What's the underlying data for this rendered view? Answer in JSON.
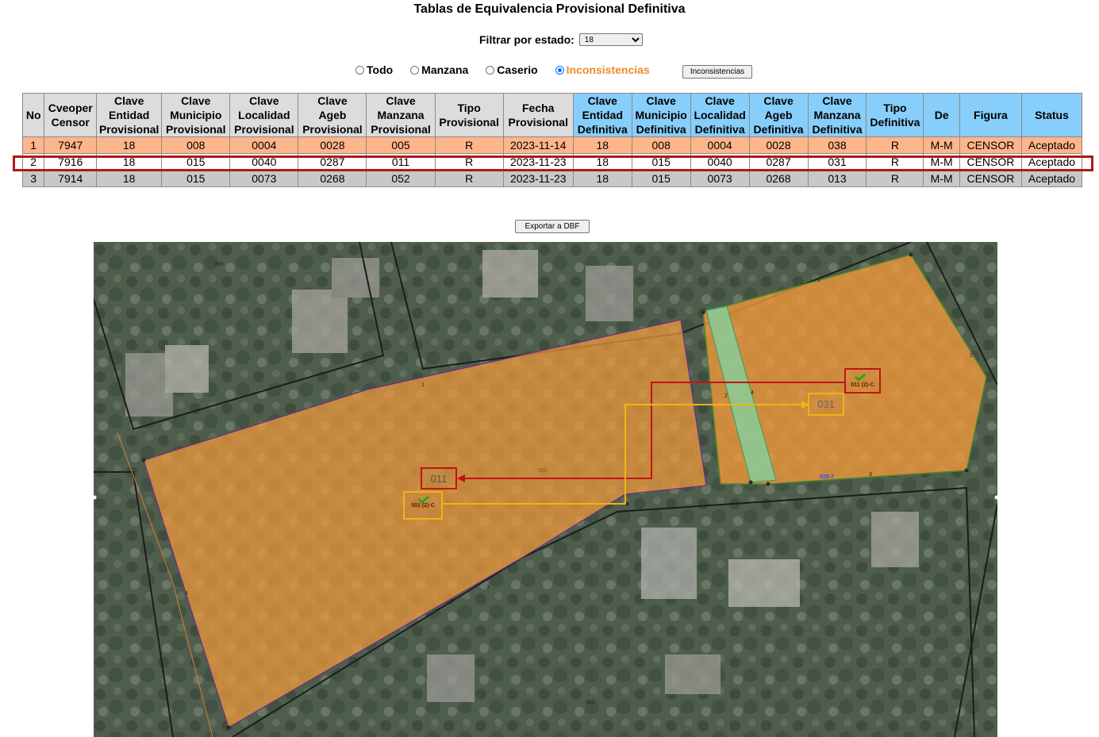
{
  "page": {
    "title": "Tablas de Equivalencia Provisional Definitiva",
    "filter_label": "Filtrar por estado:",
    "filter_value": "18",
    "radios": [
      {
        "label": "Todo",
        "selected": false
      },
      {
        "label": "Manzana",
        "selected": false
      },
      {
        "label": "Caserio",
        "selected": false
      },
      {
        "label": "Inconsistencias",
        "selected": true
      }
    ],
    "inconsistencias_button": "Inconsistencias",
    "export_button": "Exportar a DBF"
  },
  "table": {
    "headers": {
      "no": "No",
      "cveoper": [
        "Cveoper",
        "Censor"
      ],
      "ent_prov": [
        "Clave",
        "Entidad",
        "Provisional"
      ],
      "mun_prov": [
        "Clave",
        "Municipio",
        "Provisional"
      ],
      "loc_prov": [
        "Clave",
        "Localidad",
        "Provisional"
      ],
      "ageb_prov": [
        "Clave",
        "Ageb",
        "Provisional"
      ],
      "mza_prov": [
        "Clave",
        "Manzana",
        "Provisional"
      ],
      "tipo_prov": [
        "Tipo",
        "Provisional"
      ],
      "fecha_prov": [
        "Fecha",
        "Provisional"
      ],
      "ent_def": [
        "Clave",
        "Entidad",
        "Definitiva"
      ],
      "mun_def": [
        "Clave",
        "Municipio",
        "Definitiva"
      ],
      "loc_def": [
        "Clave",
        "Localidad",
        "Definitiva"
      ],
      "ageb_def": [
        "Clave",
        "Ageb",
        "Definitiva"
      ],
      "mza_def": [
        "Clave",
        "Manzana",
        "Definitiva"
      ],
      "tipo_def": [
        "Tipo",
        "Definitiva"
      ],
      "de": "De",
      "figura": "Figura",
      "status": "Status"
    },
    "rows": [
      [
        "1",
        "7947",
        "18",
        "008",
        "0004",
        "0028",
        "005",
        "R",
        "2023-11-14",
        "18",
        "008",
        "0004",
        "0028",
        "038",
        "R",
        "M-M",
        "CENSOR",
        "Aceptado"
      ],
      [
        "2",
        "7916",
        "18",
        "015",
        "0040",
        "0287",
        "011",
        "R",
        "2023-11-23",
        "18",
        "015",
        "0040",
        "0287",
        "031",
        "R",
        "M-M",
        "CENSOR",
        "Aceptado"
      ],
      [
        "3",
        "7914",
        "18",
        "015",
        "0073",
        "0268",
        "052",
        "R",
        "2023-11-23",
        "18",
        "015",
        "0073",
        "0268",
        "013",
        "R",
        "M-M",
        "CENSOR",
        "Aceptado"
      ]
    ],
    "highlighted_row": 2
  },
  "map": {
    "label_011": "011",
    "label_031": "031",
    "label_011c": "011 (2)-C",
    "label_001c": "001 (2)-C",
    "label_028": "028-7",
    "small_labels": {
      "l004": "004",
      "l021": "021",
      "l011s": "011",
      "n1a": "1",
      "n1b": "1",
      "n2": "2",
      "n3a": "3",
      "n3b": "3",
      "n4a": "4",
      "n4b": "4",
      "n2b": "2"
    },
    "colors": {
      "polygon_fill": "#f39a3c",
      "green_strip": "#7fd6a4",
      "red_marker": "#c01515",
      "yellow_marker": "#f2b312"
    }
  }
}
